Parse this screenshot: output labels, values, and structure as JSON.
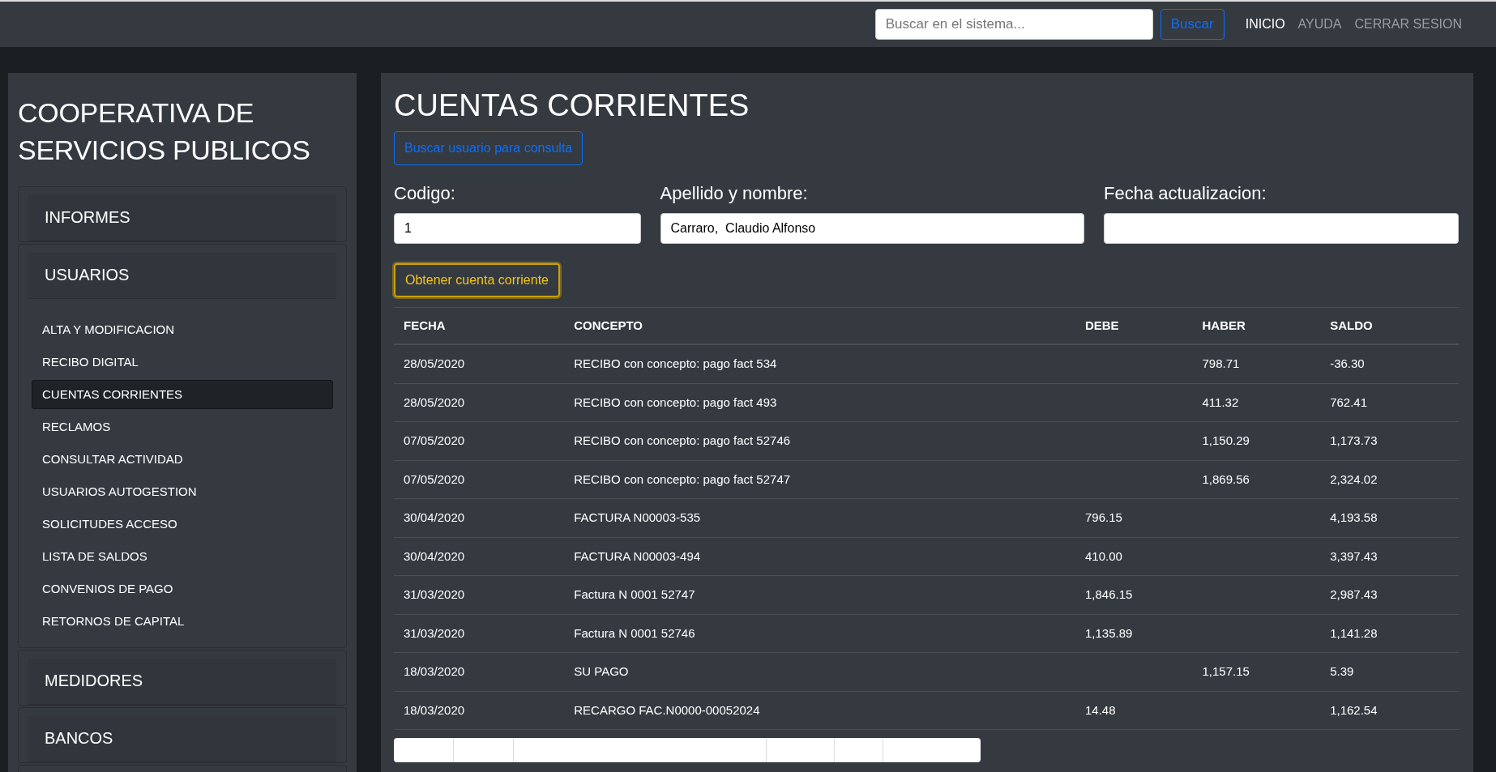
{
  "topbar": {
    "search": {
      "placeholder": "Buscar en el sistema..."
    },
    "search_button": "Buscar",
    "links": [
      {
        "label": "INICIO",
        "selected": true
      },
      {
        "label": "AYUDA",
        "selected": false
      },
      {
        "label": "CERRAR SESION",
        "selected": false
      }
    ]
  },
  "sidebar": {
    "title": "COOPERATIVA DE SERVICIOS PUBLICOS",
    "sections": [
      {
        "label": "INFORMES"
      },
      {
        "label": "USUARIOS",
        "items": [
          {
            "label": "ALTA Y MODIFICACION",
            "selected": false
          },
          {
            "label": "RECIBO DIGITAL",
            "selected": false
          },
          {
            "label": "CUENTAS CORRIENTES",
            "selected": true
          },
          {
            "label": "RECLAMOS",
            "selected": false
          },
          {
            "label": "CONSULTAR ACTIVIDAD",
            "selected": false
          },
          {
            "label": "USUARIOS AUTOGESTION",
            "selected": false
          },
          {
            "label": "SOLICITUDES ACCESO",
            "selected": false
          },
          {
            "label": "LISTA DE SALDOS",
            "selected": false
          },
          {
            "label": "CONVENIOS DE PAGO",
            "selected": false
          },
          {
            "label": "RETORNOS DE CAPITAL",
            "selected": false
          }
        ]
      },
      {
        "label": "MEDIDORES"
      },
      {
        "label": "BANCOS"
      }
    ]
  },
  "main": {
    "title": "CUENTAS CORRIENTES",
    "lookup_button": "Buscar usuario para consulta",
    "fields": [
      {
        "label": "Codigo:",
        "value": "1"
      },
      {
        "label": "Apellido y nombre:",
        "value": "Carraro,  Claudio Alfonso"
      },
      {
        "label": "Fecha actualizacion:"
      }
    ],
    "fetch_button": "Obtener cuenta corriente",
    "table": {
      "columns": [
        "FECHA",
        "CONCEPTO",
        "DEBE",
        "HABER",
        "SALDO"
      ],
      "rows": [
        [
          "28/05/2020",
          "RECIBO con concepto: pago fact 534",
          "",
          "798.71",
          "-36.30"
        ],
        [
          "28/05/2020",
          "RECIBO con concepto: pago fact 493",
          "",
          "411.32",
          "762.41"
        ],
        [
          "07/05/2020",
          "RECIBO con concepto: pago fact 52746",
          "",
          "1,150.29",
          "1,173.73"
        ],
        [
          "07/05/2020",
          "RECIBO con concepto: pago fact 52747",
          "",
          "1,869.56",
          "2,324.02"
        ],
        [
          "30/04/2020",
          "FACTURA N00003-535",
          "796.15",
          "",
          "4,193.58"
        ],
        [
          "30/04/2020",
          "FACTURA N00003-494",
          "410.00",
          "",
          "3,397.43"
        ],
        [
          "31/03/2020",
          "Factura N 0001 52747",
          "1,846.15",
          "",
          "2,987.43"
        ],
        [
          "31/03/2020",
          "Factura N 0001 52746",
          "1,135.89",
          "",
          "1,141.28"
        ],
        [
          "18/03/2020",
          "SU PAGO",
          "",
          "1,157.15",
          "5.39"
        ],
        [
          "18/03/2020",
          "RECARGO FAC.N0000-00052024",
          "14.48",
          "",
          "1,162.54"
        ]
      ]
    }
  }
}
